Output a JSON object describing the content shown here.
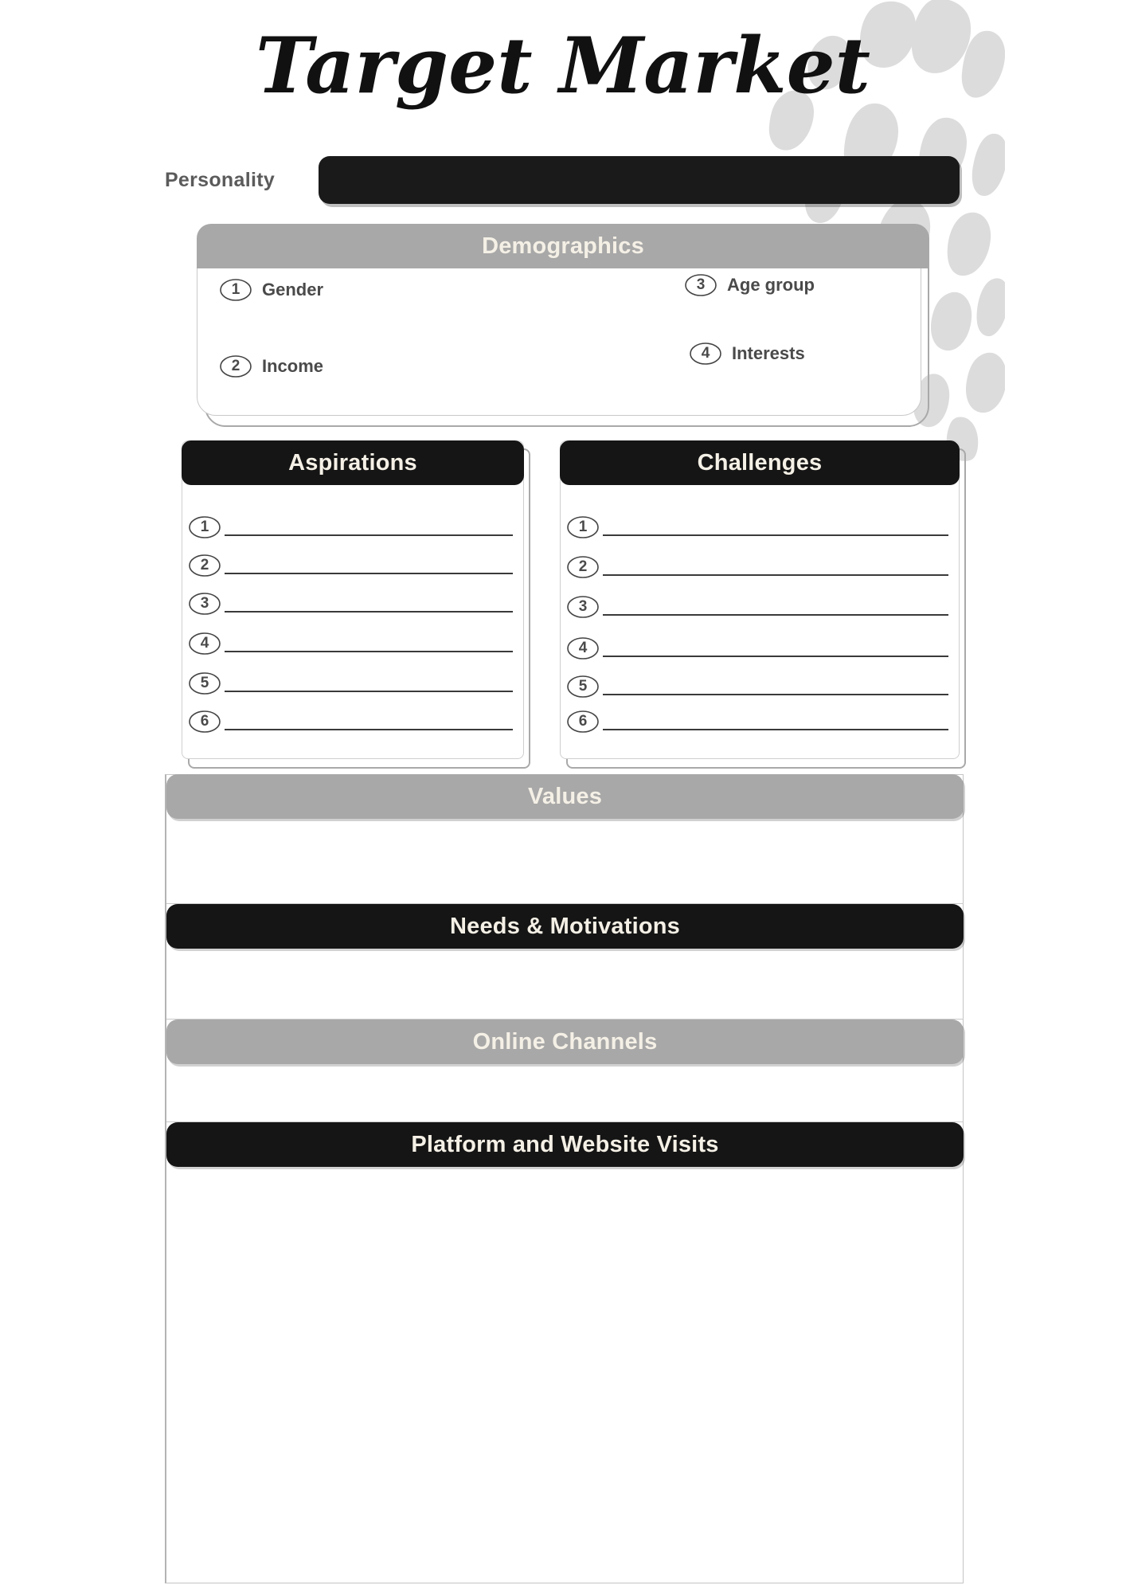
{
  "page": {
    "title": "Target Market",
    "background_color": "#ffffff",
    "accent_dark": "#151515",
    "accent_gray": "#a8a8a8",
    "text_cream": "#f5f0e6",
    "text_gray": "#4a4a4a",
    "pattern": "leopard-print"
  },
  "personality": {
    "label": "Personality",
    "value": "",
    "placeholder": ""
  },
  "demographics": {
    "header": "Demographics",
    "items": [
      {
        "number": "1",
        "label": "Gender"
      },
      {
        "number": "2",
        "label": "Income"
      },
      {
        "number": "3",
        "label": "Age group"
      },
      {
        "number": "4",
        "label": "Interests"
      }
    ]
  },
  "aspirations": {
    "header": "Aspirations",
    "rows": [
      {
        "number": "1",
        "value": ""
      },
      {
        "number": "2",
        "value": ""
      },
      {
        "number": "3",
        "value": ""
      },
      {
        "number": "4",
        "value": ""
      },
      {
        "number": "5",
        "value": ""
      },
      {
        "number": "6",
        "value": ""
      }
    ]
  },
  "challenges": {
    "header": "Challenges",
    "rows": [
      {
        "number": "1",
        "value": ""
      },
      {
        "number": "2",
        "value": ""
      },
      {
        "number": "3",
        "value": ""
      },
      {
        "number": "4",
        "value": ""
      },
      {
        "number": "5",
        "value": ""
      },
      {
        "number": "6",
        "value": ""
      }
    ]
  },
  "sections": [
    {
      "header": "Values",
      "style": "gray",
      "value": ""
    },
    {
      "header": "Needs & Motivations",
      "style": "dark",
      "value": ""
    },
    {
      "header": "Online Channels",
      "style": "gray",
      "value": ""
    },
    {
      "header": "Platform and Website Visits",
      "style": "dark",
      "value": ""
    }
  ]
}
